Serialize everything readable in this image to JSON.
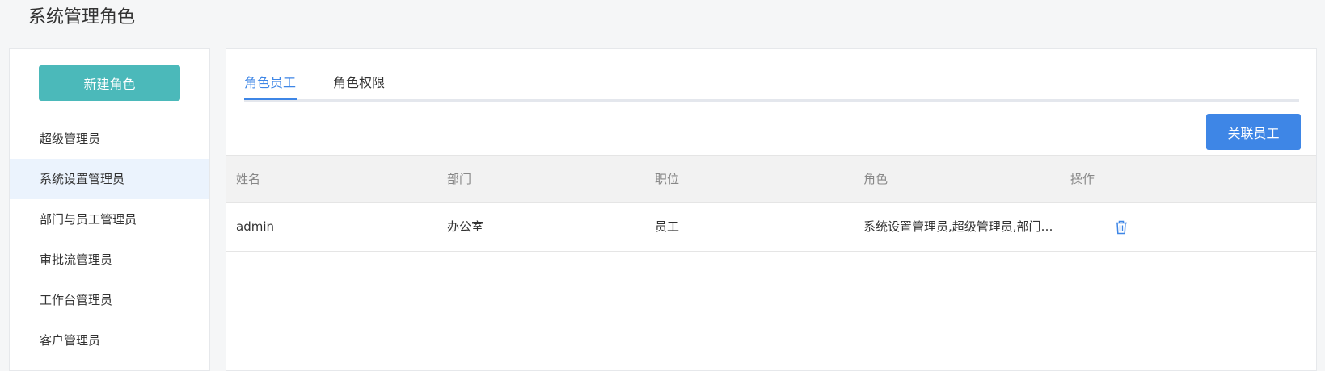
{
  "page": {
    "title": "系统管理角色"
  },
  "sidebar": {
    "new_role_label": "新建角色",
    "items": [
      {
        "label": "超级管理员",
        "active": false
      },
      {
        "label": "系统设置管理员",
        "active": true
      },
      {
        "label": "部门与员工管理员",
        "active": false
      },
      {
        "label": "审批流管理员",
        "active": false
      },
      {
        "label": "工作台管理员",
        "active": false
      },
      {
        "label": "客户管理员",
        "active": false
      }
    ]
  },
  "main": {
    "tabs": [
      {
        "label": "角色员工",
        "active": true
      },
      {
        "label": "角色权限",
        "active": false
      }
    ],
    "link_staff_label": "关联员工",
    "table": {
      "columns": [
        "姓名",
        "部门",
        "职位",
        "角色",
        "操作"
      ],
      "rows": [
        {
          "name": "admin",
          "department": "办公室",
          "position": "员工",
          "roles": "系统设置管理员,超级管理员,部门与员工管理员",
          "action_icon": "trash-icon"
        }
      ]
    }
  },
  "colors": {
    "primary": "#3e86e6",
    "teal": "#4bb9ba",
    "active_item_bg": "#ebf3fd"
  }
}
